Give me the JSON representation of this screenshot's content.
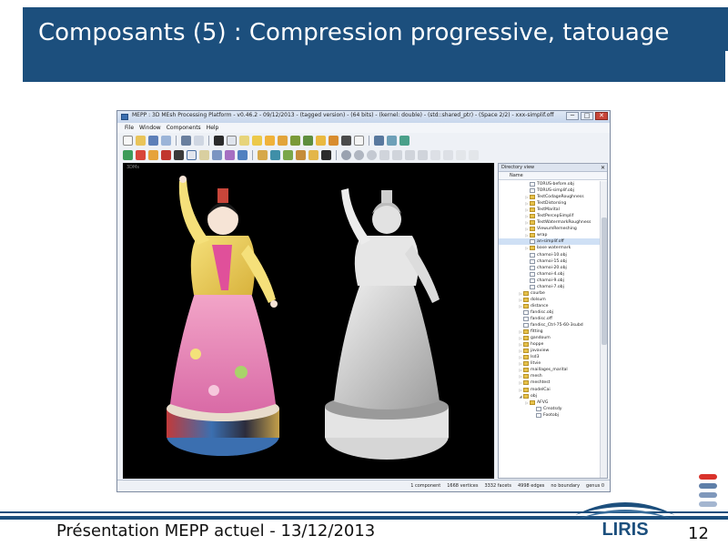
{
  "slide": {
    "title": "Composants (5) : Compression progressive, tatouage",
    "footer": "Présentation MEPP actuel - 13/12/2013",
    "page_number": "12",
    "logo_text": "LIRIS"
  },
  "app": {
    "window_title": "MEPP : 3D MEsh Processing Platform - v0.46.2 - 09/12/2013 - (tagged version) - (64 bits) - (kernel: double) - (std::shared_ptr) - (Space 2/2) - xxx-simplif.off",
    "window_buttons": {
      "minimize": "─",
      "maximize": "□",
      "close": "✕"
    },
    "menu": [
      "File",
      "Window",
      "Components",
      "Help"
    ],
    "viewport_label": "3DMs",
    "panel": {
      "title": "Directory view",
      "column": "Name",
      "close": "✕"
    },
    "tree": [
      {
        "label": "TORUS-before.obj",
        "icon": "file-icon",
        "arrow": "",
        "indent": 4,
        "selected": false
      },
      {
        "label": "TORUS-simplif.obj",
        "icon": "file-icon",
        "arrow": "",
        "indent": 4,
        "selected": false
      },
      {
        "label": "TestCodageRoughness",
        "icon": "folder-icon",
        "arrow": "▷",
        "indent": 4,
        "selected": false
      },
      {
        "label": "TestDistorsing",
        "icon": "folder-icon",
        "arrow": "▷",
        "indent": 4,
        "selected": false
      },
      {
        "label": "TestMarital",
        "icon": "folder-icon",
        "arrow": "▷",
        "indent": 4,
        "selected": false
      },
      {
        "label": "TestPercepSimplif",
        "icon": "folder-icon",
        "arrow": "▷",
        "indent": 4,
        "selected": false
      },
      {
        "label": "TestWatermarkRoughness",
        "icon": "folder-icon",
        "arrow": "▷",
        "indent": 4,
        "selected": false
      },
      {
        "label": "ViewumRemeshing",
        "icon": "folder-icon",
        "arrow": "▷",
        "indent": 4,
        "selected": false
      },
      {
        "label": "wrap",
        "icon": "folder-icon",
        "arrow": "▷",
        "indent": 4,
        "selected": false
      },
      {
        "label": "an-simplif.off",
        "icon": "file-icon",
        "arrow": "",
        "indent": 4,
        "selected": true
      },
      {
        "label": "base watermark",
        "icon": "folder-icon",
        "arrow": "▷",
        "indent": 4,
        "selected": false
      },
      {
        "label": "chamoi-10.obj",
        "icon": "file-icon",
        "arrow": "",
        "indent": 4,
        "selected": false
      },
      {
        "label": "chamoi-15.obj",
        "icon": "file-icon",
        "arrow": "",
        "indent": 4,
        "selected": false
      },
      {
        "label": "chamoi-20.obj",
        "icon": "file-icon",
        "arrow": "",
        "indent": 4,
        "selected": false
      },
      {
        "label": "chamoi-4.obj",
        "icon": "file-icon",
        "arrow": "",
        "indent": 4,
        "selected": false
      },
      {
        "label": "chamoi-9.obj",
        "icon": "file-icon",
        "arrow": "",
        "indent": 4,
        "selected": false
      },
      {
        "label": "chamoi-7.obj",
        "icon": "file-icon",
        "arrow": "",
        "indent": 4,
        "selected": false
      },
      {
        "label": "courbe",
        "icon": "folder-icon",
        "arrow": "▷",
        "indent": 3,
        "selected": false
      },
      {
        "label": "dolsum",
        "icon": "folder-icon",
        "arrow": "▷",
        "indent": 3,
        "selected": false
      },
      {
        "label": "distance",
        "icon": "folder-icon",
        "arrow": "▷",
        "indent": 3,
        "selected": false
      },
      {
        "label": "fandisc.obj",
        "icon": "file-icon",
        "arrow": "",
        "indent": 3,
        "selected": false
      },
      {
        "label": "fandisc.off",
        "icon": "file-icon",
        "arrow": "",
        "indent": 3,
        "selected": false
      },
      {
        "label": "fandisc_Ctrl-75-60-3subd",
        "icon": "file-icon",
        "arrow": "",
        "indent": 3,
        "selected": false
      },
      {
        "label": "fitting",
        "icon": "folder-icon",
        "arrow": "▷",
        "indent": 3,
        "selected": false
      },
      {
        "label": "gandoum",
        "icon": "folder-icon",
        "arrow": "▷",
        "indent": 3,
        "selected": false
      },
      {
        "label": "hoppe",
        "icon": "folder-icon",
        "arrow": "▷",
        "indent": 3,
        "selected": false
      },
      {
        "label": "javaview",
        "icon": "folder-icon",
        "arrow": "▷",
        "indent": 3,
        "selected": false
      },
      {
        "label": "lsd3",
        "icon": "folder-icon",
        "arrow": "▷",
        "indent": 3,
        "selected": false
      },
      {
        "label": "litvie",
        "icon": "folder-icon",
        "arrow": "▷",
        "indent": 3,
        "selected": false
      },
      {
        "label": "maillages_marital",
        "icon": "folder-icon",
        "arrow": "▷",
        "indent": 3,
        "selected": false
      },
      {
        "label": "mesh",
        "icon": "folder-icon",
        "arrow": "▷",
        "indent": 3,
        "selected": false
      },
      {
        "label": "meshtest",
        "icon": "folder-icon",
        "arrow": "▷",
        "indent": 3,
        "selected": false
      },
      {
        "label": "modelCai",
        "icon": "folder-icon",
        "arrow": "▷",
        "indent": 3,
        "selected": false
      },
      {
        "label": "obj",
        "icon": "folder-icon",
        "arrow": "◢",
        "indent": 3,
        "selected": false
      },
      {
        "label": "AFVG",
        "icon": "folder-icon",
        "arrow": "▷",
        "indent": 4,
        "selected": false
      },
      {
        "label": "Creatsdy",
        "icon": "file-icon",
        "arrow": "",
        "indent": 5,
        "selected": false
      },
      {
        "label": "Footobj",
        "icon": "file-icon",
        "arrow": "",
        "indent": 5,
        "selected": false
      }
    ],
    "status": [
      "1 component",
      "1668 vertices",
      "3332 facets",
      "4998 edges",
      "no boundary",
      "genus 0"
    ]
  },
  "colors": {
    "title_bg": "#1c4f7d",
    "accent_red": "#d9322b",
    "logo_blue": "#1c4f7d"
  }
}
